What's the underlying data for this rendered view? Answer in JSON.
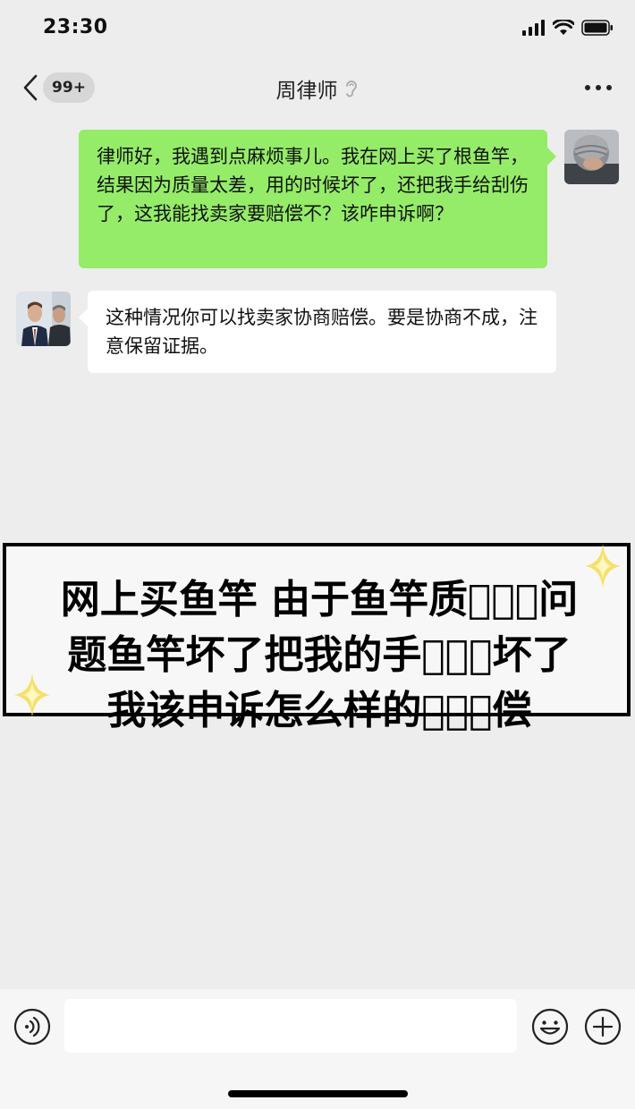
{
  "status_bar": {
    "time": "23:30"
  },
  "nav": {
    "unread_badge": "99+",
    "title": "周律师",
    "title_icon": "ear-icon",
    "more_icon": "more-dots-icon"
  },
  "messages": [
    {
      "side": "right",
      "text": "律师好，我遇到点麻烦事儿。我在网上买了根鱼竿，结果因为质量太差，用的时候坏了，还把我手给刮伤了，这我能找卖家要赔偿不？该咋申诉啊？"
    },
    {
      "side": "left",
      "text": "这种情况你可以找卖家协商赔偿。要是协商不成，注意保留证据。"
    }
  ],
  "overlay": {
    "text": "网上买鱼竿 由于鱼竿质\u0000\u0000\u0000问题鱼竿坏了把我的手\u0000\u0000\u0000坏了我该申诉怎么样的\u0000\u0000\u0000偿"
  },
  "input_bar": {
    "placeholder": "",
    "voice_icon": "voice-icon",
    "emoji_icon": "emoji-icon",
    "plus_icon": "plus-icon"
  },
  "colors": {
    "background": "#ededed",
    "my_bubble": "#95ec69",
    "their_bubble": "#ffffff",
    "sparkle": "#f7e26b"
  }
}
